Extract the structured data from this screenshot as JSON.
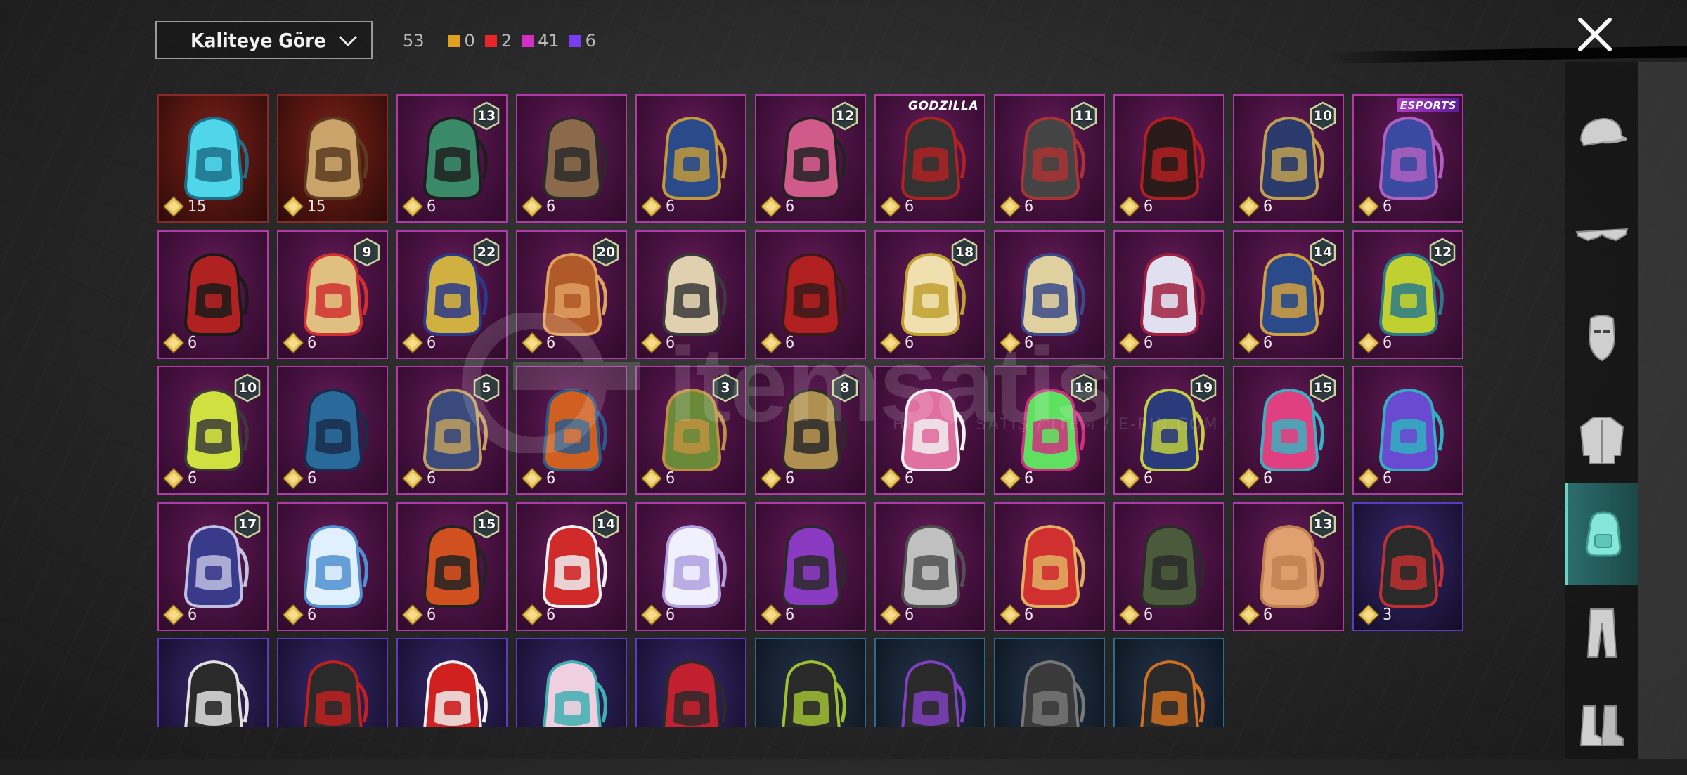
{
  "header": {
    "sort_label": "Kaliteye Göre",
    "total_count": "53",
    "quality_counts": [
      {
        "color": "#e0a21e",
        "value": "0"
      },
      {
        "color": "#e8262a",
        "value": "2"
      },
      {
        "color": "#d42fc4",
        "value": "41"
      },
      {
        "color": "#7a3cf0",
        "value": "6"
      }
    ]
  },
  "watermark": {
    "brand": "itemsatis",
    "tagline": "HESAP / SATIŞ / ITEM / E-PIN.COM"
  },
  "items": [
    {
      "row": 0,
      "col": 0,
      "tier": "red",
      "price": "15",
      "level": "",
      "tag": "",
      "art": "blue-gourd-backpack"
    },
    {
      "row": 0,
      "col": 1,
      "tier": "red",
      "price": "15",
      "level": "",
      "tag": "",
      "art": "shrine-backpack"
    },
    {
      "row": 0,
      "col": 2,
      "tier": "pink",
      "price": "6",
      "level": "13",
      "tag": "",
      "art": "tech-backpack"
    },
    {
      "row": 0,
      "col": 3,
      "tier": "pink",
      "price": "6",
      "level": "",
      "tag": "",
      "art": "pirate-backpack"
    },
    {
      "row": 0,
      "col": 4,
      "tier": "pink",
      "price": "6",
      "level": "",
      "tag": "",
      "art": "pharaoh-backpack"
    },
    {
      "row": 0,
      "col": 5,
      "tier": "pink",
      "price": "6",
      "level": "12",
      "tag": "",
      "art": "rose-backpack"
    },
    {
      "row": 0,
      "col": 6,
      "tier": "pink",
      "price": "6",
      "level": "",
      "tag": "GODZILLA",
      "art": "godzilla-backpack"
    },
    {
      "row": 0,
      "col": 7,
      "tier": "pink",
      "price": "6",
      "level": "11",
      "tag": "",
      "art": "sword-backpack"
    },
    {
      "row": 0,
      "col": 8,
      "tier": "pink",
      "price": "6",
      "level": "",
      "tag": "",
      "art": "dark-red-backpack"
    },
    {
      "row": 0,
      "col": 9,
      "tier": "pink",
      "price": "6",
      "level": "10",
      "tag": "",
      "art": "navy-gold-backpack"
    },
    {
      "row": 0,
      "col": 10,
      "tier": "pink",
      "price": "6",
      "level": "",
      "tag": "ESPORTS",
      "art": "esports-backpack"
    },
    {
      "row": 1,
      "col": 0,
      "tier": "pink",
      "price": "6",
      "level": "",
      "tag": "",
      "art": "red-black-backpack"
    },
    {
      "row": 1,
      "col": 1,
      "tier": "pink",
      "price": "6",
      "level": "9",
      "tag": "",
      "art": "doll-backpack"
    },
    {
      "row": 1,
      "col": 2,
      "tier": "pink",
      "price": "6",
      "level": "22",
      "tag": "",
      "art": "pharaoh-gold-backpack"
    },
    {
      "row": 1,
      "col": 3,
      "tier": "pink",
      "price": "6",
      "level": "20",
      "tag": "",
      "art": "bear-backpack"
    },
    {
      "row": 1,
      "col": 4,
      "tier": "pink",
      "price": "6",
      "level": "",
      "tag": "",
      "art": "cat-backpack"
    },
    {
      "row": 1,
      "col": 5,
      "tier": "pink",
      "price": "6",
      "level": "",
      "tag": "",
      "art": "dragon-red-backpack"
    },
    {
      "row": 1,
      "col": 6,
      "tier": "pink",
      "price": "6",
      "level": "18",
      "tag": "",
      "art": "mask-backpack"
    },
    {
      "row": 1,
      "col": 7,
      "tier": "pink",
      "price": "6",
      "level": "",
      "tag": "",
      "art": "gold-white-backpack"
    },
    {
      "row": 1,
      "col": 8,
      "tier": "pink",
      "price": "6",
      "level": "",
      "tag": "",
      "art": "maid-backpack"
    },
    {
      "row": 1,
      "col": 9,
      "tier": "pink",
      "price": "6",
      "level": "14",
      "tag": "",
      "art": "treasure-backpack"
    },
    {
      "row": 1,
      "col": 10,
      "tier": "pink",
      "price": "6",
      "level": "12",
      "tag": "",
      "art": "yellow-teal-backpack"
    },
    {
      "row": 2,
      "col": 0,
      "tier": "pink",
      "price": "6",
      "level": "10",
      "tag": "",
      "art": "phone-backpack"
    },
    {
      "row": 2,
      "col": 1,
      "tier": "pink",
      "price": "6",
      "level": "",
      "tag": "",
      "art": "blue-armor-backpack"
    },
    {
      "row": 2,
      "col": 2,
      "tier": "pink",
      "price": "6",
      "level": "5",
      "tag": "",
      "art": "ornate-backpack"
    },
    {
      "row": 2,
      "col": 3,
      "tier": "pink",
      "price": "6",
      "level": "",
      "tag": "",
      "art": "orange-blue-backpack"
    },
    {
      "row": 2,
      "col": 4,
      "tier": "pink",
      "price": "6",
      "level": "3",
      "tag": "",
      "art": "crate-backpack"
    },
    {
      "row": 2,
      "col": 5,
      "tier": "pink",
      "price": "6",
      "level": "8",
      "tag": "",
      "art": "tan-backpack"
    },
    {
      "row": 2,
      "col": 6,
      "tier": "pink",
      "price": "6",
      "level": "",
      "tag": "",
      "art": "pink-cat-backpack"
    },
    {
      "row": 2,
      "col": 7,
      "tier": "pink",
      "price": "6",
      "level": "18",
      "tag": "",
      "art": "neon-backpack"
    },
    {
      "row": 2,
      "col": 8,
      "tier": "pink",
      "price": "6",
      "level": "19",
      "tag": "",
      "art": "beetle-backpack"
    },
    {
      "row": 2,
      "col": 9,
      "tier": "pink",
      "price": "6",
      "level": "15",
      "tag": "",
      "art": "robot-backpack"
    },
    {
      "row": 2,
      "col": 10,
      "tier": "pink",
      "price": "6",
      "level": "",
      "tag": "",
      "art": "purple-teal-backpack"
    },
    {
      "row": 3,
      "col": 0,
      "tier": "pink",
      "price": "6",
      "level": "17",
      "tag": "",
      "art": "samurai-backpack"
    },
    {
      "row": 3,
      "col": 1,
      "tier": "pink",
      "price": "6",
      "level": "",
      "tag": "",
      "art": "snowman-backpack"
    },
    {
      "row": 3,
      "col": 2,
      "tier": "pink",
      "price": "6",
      "level": "15",
      "tag": "",
      "art": "fire-backpack"
    },
    {
      "row": 3,
      "col": 3,
      "tier": "pink",
      "price": "6",
      "level": "14",
      "tag": "",
      "art": "red-robot-backpack"
    },
    {
      "row": 3,
      "col": 4,
      "tier": "pink",
      "price": "6",
      "level": "",
      "tag": "",
      "art": "unicorn-backpack"
    },
    {
      "row": 3,
      "col": 5,
      "tier": "pink",
      "price": "6",
      "level": "",
      "tag": "",
      "art": "purple-mask-backpack"
    },
    {
      "row": 3,
      "col": 6,
      "tier": "pink",
      "price": "6",
      "level": "",
      "tag": "",
      "art": "silver-backpack"
    },
    {
      "row": 3,
      "col": 7,
      "tier": "pink",
      "price": "6",
      "level": "",
      "tag": "",
      "art": "monkey-backpack"
    },
    {
      "row": 3,
      "col": 8,
      "tier": "pink",
      "price": "6",
      "level": "",
      "tag": "",
      "art": "camo-backpack"
    },
    {
      "row": 3,
      "col": 9,
      "tier": "pink",
      "price": "6",
      "level": "13",
      "tag": "",
      "art": "orange-box-backpack"
    },
    {
      "row": 3,
      "col": 10,
      "tier": "purple",
      "price": "3",
      "level": "",
      "tag": "",
      "art": "red-pattern-backpack"
    },
    {
      "row": 4,
      "col": 0,
      "tier": "purple",
      "price": "",
      "level": "",
      "tag": "",
      "art": "black-x-backpack"
    },
    {
      "row": 4,
      "col": 1,
      "tier": "purple",
      "price": "",
      "level": "",
      "tag": "",
      "art": "black-red-backpack"
    },
    {
      "row": 4,
      "col": 2,
      "tier": "purple",
      "price": "",
      "level": "",
      "tag": "",
      "art": "red-football-backpack"
    },
    {
      "row": 4,
      "col": 3,
      "tier": "purple",
      "price": "",
      "level": "",
      "tag": "",
      "art": "girl-backpack"
    },
    {
      "row": 4,
      "col": 4,
      "tier": "purple",
      "price": "",
      "level": "",
      "tag": "",
      "art": "christmas-backpack"
    },
    {
      "row": 4,
      "col": 5,
      "tier": "blue",
      "price": "",
      "level": "",
      "tag": "",
      "art": "black-green-backpack"
    },
    {
      "row": 4,
      "col": 6,
      "tier": "blue",
      "price": "",
      "level": "",
      "tag": "",
      "art": "black-purple-backpack"
    },
    {
      "row": 4,
      "col": 7,
      "tier": "blue",
      "price": "",
      "level": "",
      "tag": "",
      "art": "grey-backpack"
    },
    {
      "row": 4,
      "col": 8,
      "tier": "blue",
      "price": "",
      "level": "",
      "tag": "",
      "art": "black-orange-backpack"
    }
  ],
  "categories": [
    {
      "id": "cap",
      "icon": "cap-icon",
      "active": false
    },
    {
      "id": "glasses",
      "icon": "glasses-icon",
      "active": false
    },
    {
      "id": "mask",
      "icon": "mask-icon",
      "active": false
    },
    {
      "id": "jacket",
      "icon": "jacket-icon",
      "active": false
    },
    {
      "id": "backpack",
      "icon": "backpack-icon",
      "active": true
    },
    {
      "id": "pants",
      "icon": "pants-icon",
      "active": false
    },
    {
      "id": "boots",
      "icon": "boots-icon",
      "active": false
    }
  ],
  "colors": {
    "tier_red": "#8a2a26",
    "tier_pink": "#b13aa8",
    "tier_purple": "#5d3bc1",
    "tier_blue": "#2a6b8e",
    "accent": "#6cd2c7",
    "gem": "#e8c35a"
  }
}
